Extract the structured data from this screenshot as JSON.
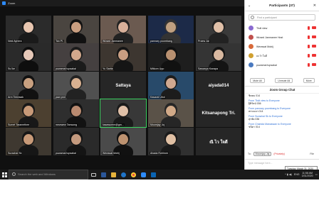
{
  "window": {
    "title": "Zoom"
  },
  "tiles": [
    {
      "name": "Nest Ayhera",
      "color": "#2b2b2b",
      "skin": "#e8c6b0",
      "hair": "#1a1a1a"
    },
    {
      "name": "Tan Pl.",
      "color": "#4a4540",
      "skin": "#c99e80",
      "hair": "#111"
    },
    {
      "name": "Wizard Janmanee",
      "color": "#6b5a50",
      "skin": "#d8b09a",
      "hair": "#222"
    },
    {
      "name": "pannary poombang",
      "color": "#1c2a48",
      "skin": "#c0a080",
      "hair": "#333"
    },
    {
      "name": "Praew Jai",
      "color": "#3a3a3a",
      "skin": "#e0c0a8",
      "hair": "#222"
    },
    {
      "name": "Ss Ike",
      "color": "#2a2a2a",
      "skin": "#e6c8b8",
      "hair": "#0e0e0e"
    },
    {
      "name": "puwamai tupsakal",
      "color": "#454040",
      "skin": "#d2a88c",
      "hair": "#1b1b1b"
    },
    {
      "name": "Yu Sarita",
      "color": "#3d3630",
      "skin": "#c99e82",
      "hair": "#151515"
    },
    {
      "name": "Mitkorn Upp",
      "color": "#1e1e1e",
      "skin": "#b89070",
      "hair": "#111"
    },
    {
      "name": "Sawanya Kseapa",
      "color": "#343434",
      "skin": "#d8b8a0",
      "hair": "#141414"
    },
    {
      "name": "Arm Teerasak",
      "color": "#3b3b3b",
      "skin": "#c8a080",
      "hair": "#111"
    },
    {
      "name": "paw prot",
      "color": "#505050",
      "skin": "#d8b090",
      "hair": "#222"
    },
    {
      "name": "Sattaya",
      "text": true
    },
    {
      "name": "Kasarat Ubol",
      "color": "#284a6a",
      "skin": "#d0a890",
      "hair": "#1c1c1c"
    },
    {
      "name": "aiyada014",
      "text": true
    },
    {
      "name": "Sumet Taramethee",
      "color": "#4c4030",
      "skin": "#c89a78",
      "hair": "#181818"
    },
    {
      "name": "mewwew Tanwong",
      "color": "#2e2e2e",
      "skin": "#b98a70",
      "hair": "#121212"
    },
    {
      "name": "kawasumm@gm...",
      "color": "#383838",
      "skin": "#e0c0a8",
      "hair": "#1a1a1a",
      "selected": true
    },
    {
      "name": "Moomjay Joj",
      "color": "#5a5248",
      "skin": "#d2aa88",
      "hair": "#262626"
    },
    {
      "name": "Kitsanapong Tri.",
      "text": true
    },
    {
      "name": "Surachai Sk",
      "color": "#3e3830",
      "skin": "#c89a78",
      "hair": "#161616"
    },
    {
      "name": "puwamai tupsakal",
      "color": "#2a2a2a",
      "skin": "#c49a7e",
      "hair": "#141414"
    },
    {
      "name": "Werawat Mohij",
      "color": "#4a4a4a",
      "skin": "#bd9270",
      "hair": "#111"
    },
    {
      "name": "Ahada Rohirom",
      "color": "#303030",
      "skin": "#e0c0a4",
      "hair": "#1a1a1a"
    },
    {
      "name": "ณิ ไว ใจดี",
      "text": true
    }
  ],
  "participants": {
    "title": "Participants (37)",
    "search_placeholder": "Find a participant",
    "items": [
      {
        "name": "Thất view",
        "av": "#8a6ad0"
      },
      {
        "name": "Wizard Janmanee Host",
        "av": "#c0504d"
      },
      {
        "name": "Werawat Mobij",
        "av": "#d86a3a"
      },
      {
        "name": "cc Tr ใจดี",
        "av": "#d0a030"
      },
      {
        "name": "puwamai tupsakal",
        "av": "#4a7ac0"
      }
    ],
    "buttons": {
      "mute_all": "Mute All",
      "unmute_all": "Unmute All",
      "more": "More"
    }
  },
  "chat": {
    "title": "Zoom Group Chat",
    "messages": [
      {
        "from": "",
        "text": "ชิตตม 014"
      },
      {
        "from": "From Thất view to Everyone",
        "text": "ฐิติรัตน์ 036"
      },
      {
        "from": "From pannary poombang to Everyone",
        "text": "พรรณษา 014"
      },
      {
        "from": "From Surachai Sk to Everyone",
        "text": "สุรชัย 036"
      },
      {
        "from": "From Chanida Manaswan to Everyone",
        "text": "ชนิดา 014"
      }
    ],
    "to_label": "To:",
    "to_value": "Moomjay Jaj",
    "privately": "(Privately)",
    "file_label": "File",
    "input_placeholder": "Type message here..."
  },
  "tooltip": "Tuesday, March 31, 2020",
  "taskbar": {
    "search_placeholder": "Search the web and Windows",
    "lang": "ENG",
    "time": "11:58 AM",
    "date": "3/31/2020"
  }
}
